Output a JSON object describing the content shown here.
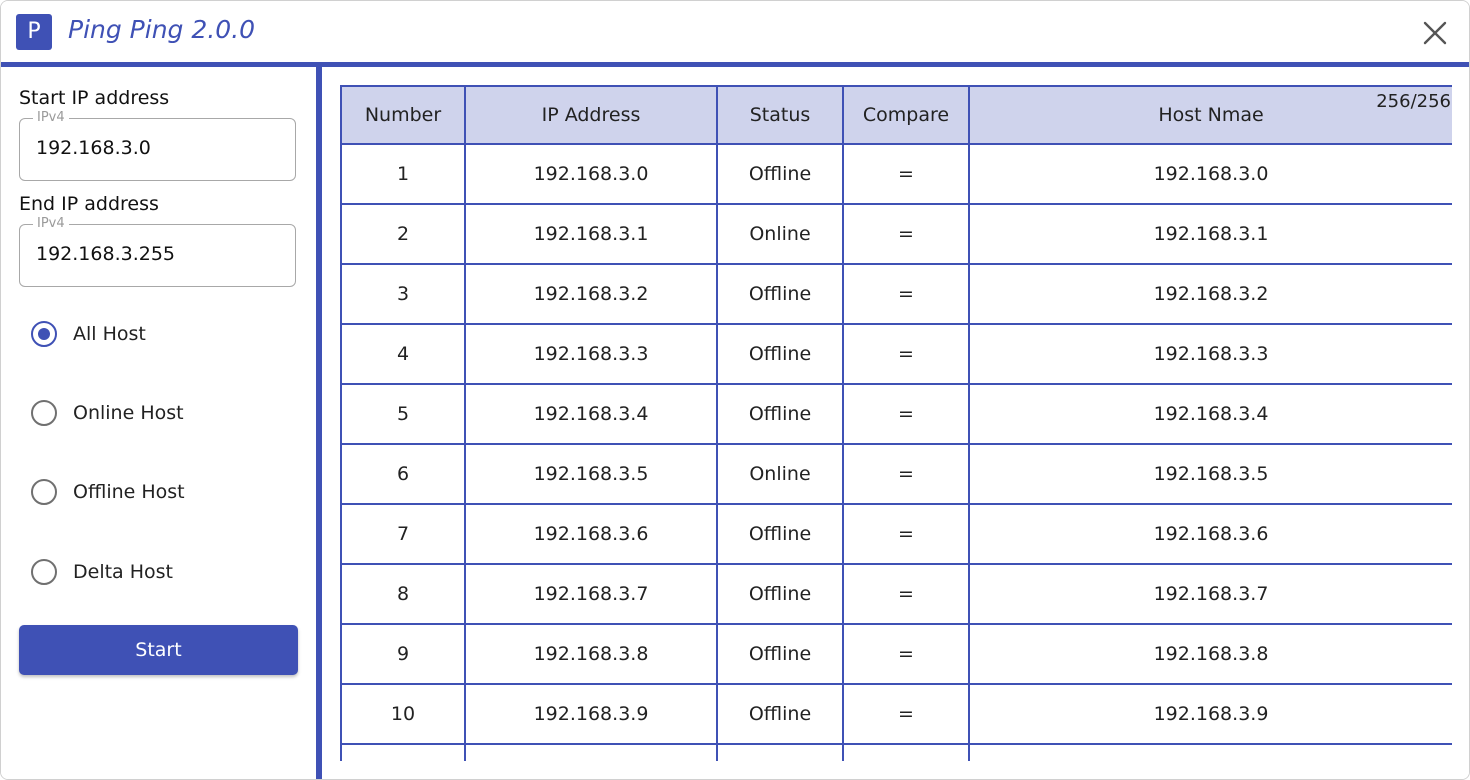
{
  "app": {
    "icon_letter": "P",
    "title": "Ping Ping 2.0.0"
  },
  "form": {
    "start_label": "Start IP address",
    "start_legend": "IPv4",
    "start_value": "192.168.3.0",
    "end_label": "End IP address",
    "end_legend": "IPv4",
    "end_value": "192.168.3.255",
    "filters": [
      {
        "label": "All Host",
        "checked": true
      },
      {
        "label": "Online Host",
        "checked": false
      },
      {
        "label": "Offline Host",
        "checked": false
      },
      {
        "label": "Delta Host",
        "checked": false
      }
    ],
    "start_button": "Start"
  },
  "results": {
    "counter": "256/256",
    "columns": [
      "Number",
      "IP Address",
      "Status",
      "Compare",
      "Host Nmae"
    ],
    "rows": [
      {
        "number": "1",
        "ip": "192.168.3.0",
        "status": "Offline",
        "compare": "=",
        "host": "192.168.3.0"
      },
      {
        "number": "2",
        "ip": "192.168.3.1",
        "status": "Online",
        "compare": "=",
        "host": "192.168.3.1"
      },
      {
        "number": "3",
        "ip": "192.168.3.2",
        "status": "Offline",
        "compare": "=",
        "host": "192.168.3.2"
      },
      {
        "number": "4",
        "ip": "192.168.3.3",
        "status": "Offline",
        "compare": "=",
        "host": "192.168.3.3"
      },
      {
        "number": "5",
        "ip": "192.168.3.4",
        "status": "Offline",
        "compare": "=",
        "host": "192.168.3.4"
      },
      {
        "number": "6",
        "ip": "192.168.3.5",
        "status": "Online",
        "compare": "=",
        "host": "192.168.3.5"
      },
      {
        "number": "7",
        "ip": "192.168.3.6",
        "status": "Offline",
        "compare": "=",
        "host": "192.168.3.6"
      },
      {
        "number": "8",
        "ip": "192.168.3.7",
        "status": "Offline",
        "compare": "=",
        "host": "192.168.3.7"
      },
      {
        "number": "9",
        "ip": "192.168.3.8",
        "status": "Offline",
        "compare": "=",
        "host": "192.168.3.8"
      },
      {
        "number": "10",
        "ip": "192.168.3.9",
        "status": "Offline",
        "compare": "=",
        "host": "192.168.3.9"
      },
      {
        "number": "",
        "ip": "",
        "status": "",
        "compare": "",
        "host": ""
      }
    ]
  },
  "colors": {
    "accent": "#3f51b5",
    "header_bg": "#cfd3ec",
    "offline": "#e53935",
    "online": "#43a047"
  },
  "icons": {
    "close": "close-icon"
  }
}
